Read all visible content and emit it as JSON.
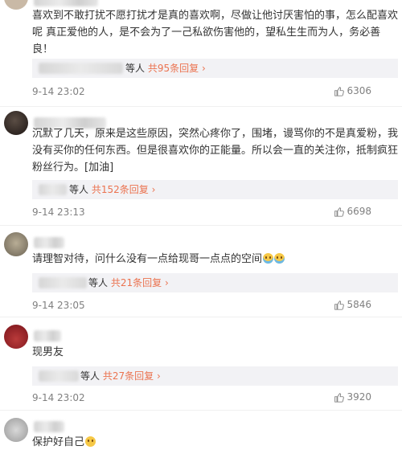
{
  "comments": [
    {
      "text": "喜欢到不敢打扰不愿打扰才是真的喜欢啊，尽做让他讨厌害怕的事，怎么配喜欢呢 真正爱他的人，是不会为了一己私欲伤害他的，望私生生而为人，务必善良！",
      "reply_prefix": "等人",
      "reply_link": "共95条回复",
      "time": "9-14 23:02",
      "likes": "6306"
    },
    {
      "text": "沉默了几天，原来是这些原因，突然心疼你了，围堵，谩骂你的不是真爱粉，我没有买你的任何东西。但是很喜欢你的正能量。所以会一直的关注你，抵制疯狂粉丝行为。[加油]",
      "reply_prefix": "等人",
      "reply_link": "共152条回复",
      "time": "9-14 23:13",
      "likes": "6698"
    },
    {
      "text": "请理智对待，问什么没有一点给现哥一点点的空间",
      "reply_prefix": "等人",
      "reply_link": "共21条回复",
      "time": "9-14 23:05",
      "likes": "5846"
    },
    {
      "text": "现男友",
      "reply_prefix": "等人",
      "reply_link": "共27条回复",
      "time": "9-14 23:02",
      "likes": "3920"
    },
    {
      "text": "保护好自己"
    }
  ],
  "icons": {
    "like": "thumbs-up-icon",
    "reply_arrow": "chevron-right-icon",
    "emoji_cry": "crying-face-emoji-icon",
    "emoji_worried": "worried-face-emoji-icon"
  },
  "colors": {
    "link": "#eb7350",
    "meta": "#808080",
    "reply_bg": "#f2f2f5"
  }
}
